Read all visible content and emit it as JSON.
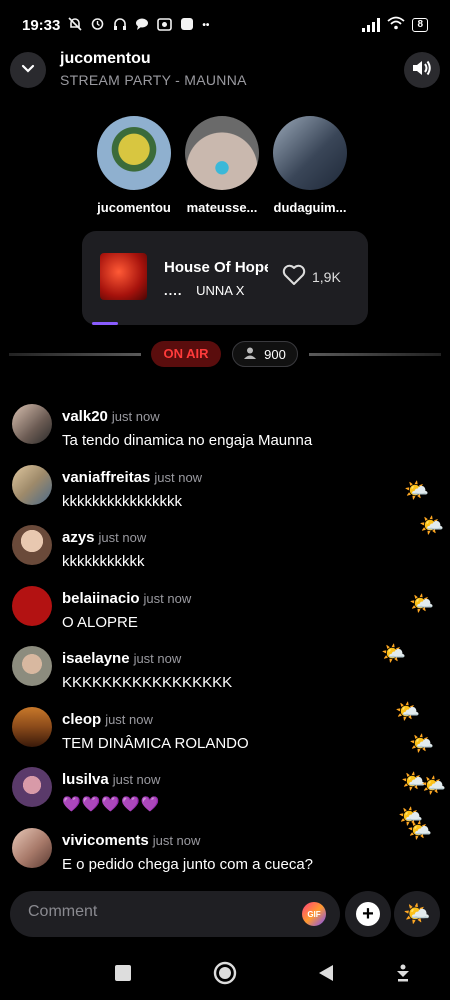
{
  "status_bar": {
    "time": "19:33",
    "left_icons": [
      "bell-off-icon",
      "alarm-icon",
      "headphones-icon",
      "chat-bubble-icon",
      "camera-icon",
      "square-icon"
    ],
    "more": "••",
    "battery": "8"
  },
  "header": {
    "title": "jucomentou",
    "subtitle": "STREAM PARTY - MAUNNA"
  },
  "hosts": [
    {
      "name": "jucomentou",
      "color": "#8fb0cf"
    },
    {
      "name": "mateusse...",
      "color": "#b9a9a3"
    },
    {
      "name": "dudaguim...",
      "color": "#5a6a82"
    }
  ],
  "music": {
    "title": "House Of Hope",
    "artist": "UNNA X",
    "likes": "1,9K"
  },
  "live": {
    "badge": "ON AIR",
    "viewers": "900"
  },
  "chat": [
    {
      "user": "valk20",
      "time": "just now",
      "text": "Ta tendo dinamica no engaja Maunna",
      "avatar": "#7a6a62"
    },
    {
      "user": "vaniaffreitas",
      "time": "just now",
      "text": "kkkkkkkkkkkkkkkk",
      "avatar": "#9e8a6a"
    },
    {
      "user": "azys",
      "time": "just now",
      "text": "kkkkkkkkkkk",
      "avatar": "#c9a58a"
    },
    {
      "user": "belaiinacio",
      "time": "just now",
      "text": "O ALOPRE",
      "avatar": "#b31212"
    },
    {
      "user": "isaelayne",
      "time": "just now",
      "text": "KKKKKKKKKKKKKKKKK",
      "avatar": "#8c8c7e"
    },
    {
      "user": "cleop",
      "time": "just now",
      "text": "TEM DINÂMICA ROLANDO",
      "avatar": "#8a4a1a"
    },
    {
      "user": "lusilva",
      "time": "just now",
      "text": "💜💜💜💜💜",
      "avatar": "#5a3a6a"
    },
    {
      "user": "vivicoments",
      "time": "just now",
      "text": "E o pedido chega junto com a cueca?",
      "avatar": "#a87a6a"
    }
  ],
  "reaction_icon": "🌤️",
  "composer": {
    "placeholder": "Comment",
    "gif_label": "GIF",
    "plus_label": "+"
  }
}
